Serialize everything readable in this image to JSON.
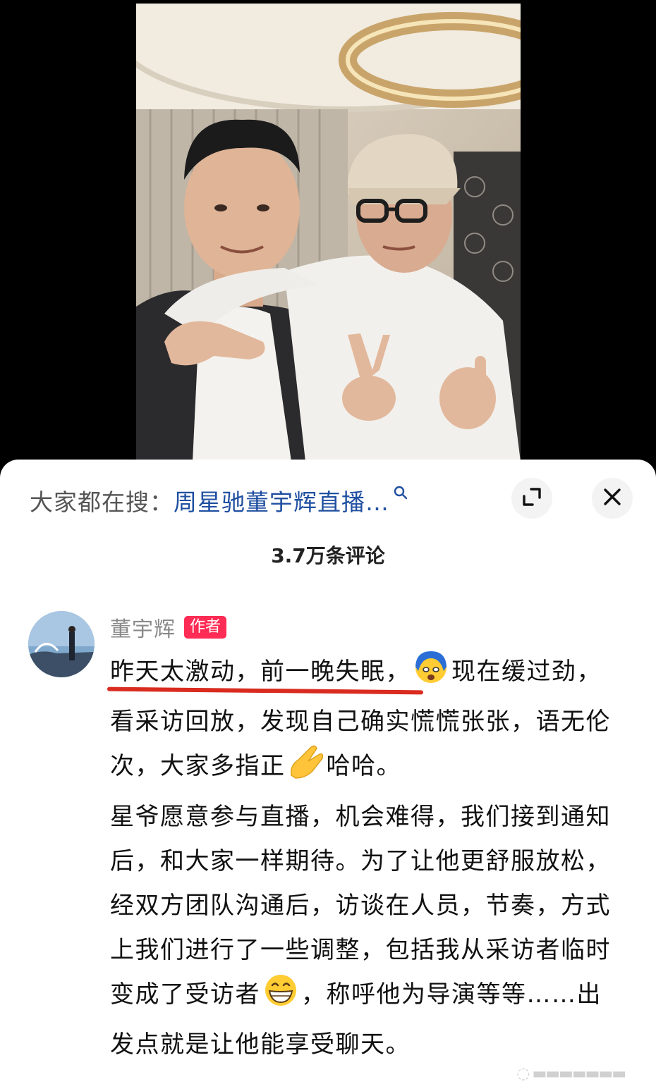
{
  "search": {
    "prefix": "大家都在搜：",
    "term": "周星驰董宇辉直播…"
  },
  "comments_header": {
    "count_label": "3.7万条评论"
  },
  "comment": {
    "author": "董宇辉",
    "badge": "作者",
    "para1": {
      "part1": "昨天太激动，前一晚失眠，",
      "part2": "现在缓过劲，看采访回放，发现自己确实慌慌张张，语无伦次，大家多指正",
      "part3": "哈哈。"
    },
    "para2": {
      "part1": "星爷愿意参与直播，机会难得，我们接到通知后，和大家一样期待。为了让他更舒服放松，经双方团队沟通后，访谈在人员，节奏，方式上我们进行了一些调整，包括我从采访者临时变成了受访者",
      "part2": "，称呼他为导演等等……出发点就是让他能享受聊天。"
    }
  },
  "icons": {
    "search": "search-icon",
    "expand": "expand-icon",
    "close": "close-icon",
    "emoji1": "overwhelmed-face-emoji-icon",
    "emoji2": "clasped-hands-emoji-icon",
    "emoji3": "grinning-face-emoji-icon"
  },
  "colors": {
    "link_blue": "#1f4fa0",
    "badge_red": "#ff2c55",
    "underline_red": "#d92b1f"
  }
}
